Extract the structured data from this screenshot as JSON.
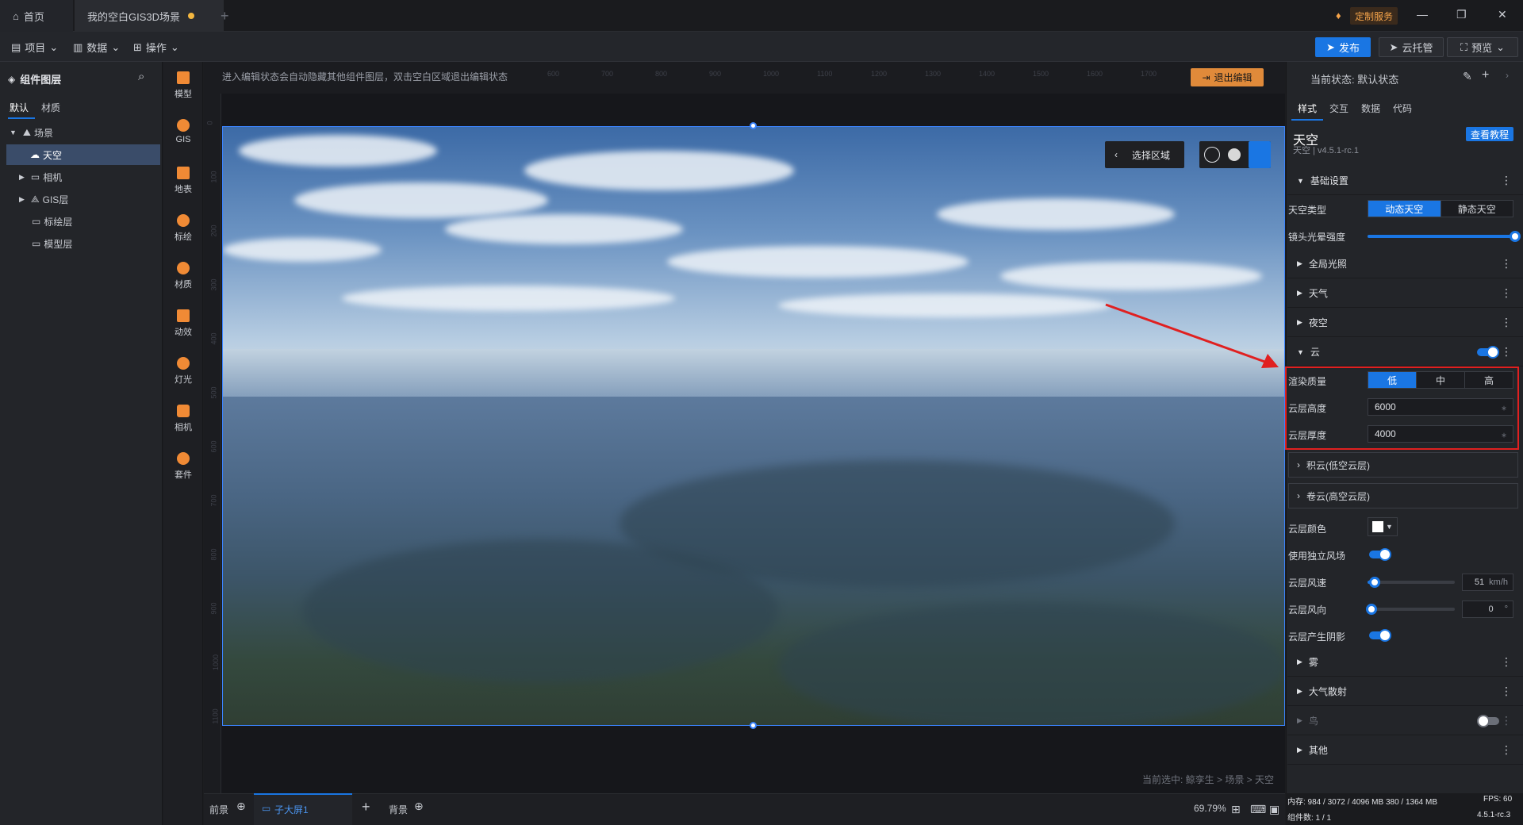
{
  "titlebar": {
    "home_tab": "首页",
    "doc_tab": "我的空白GIS3D场景",
    "custom_service": "定制服务",
    "win_min": "—",
    "win_max": "❐",
    "win_close": "✕"
  },
  "menubar": {
    "project": "项目",
    "data": "数据",
    "operate": "操作",
    "publish": "发布",
    "cloud_host": "云托管",
    "preview": "预览"
  },
  "left_panel": {
    "title": "组件图层",
    "tabs": [
      "默认",
      "材质"
    ],
    "tree": [
      {
        "label": "场景"
      },
      {
        "label": "天空"
      },
      {
        "label": "相机"
      },
      {
        "label": "GIS层"
      },
      {
        "label": "标绘层"
      },
      {
        "label": "模型层"
      }
    ]
  },
  "tools": [
    "模型",
    "GIS",
    "地表",
    "标绘",
    "材质",
    "动效",
    "灯光",
    "相机",
    "套件"
  ],
  "canvas": {
    "hint": "进入编辑状态会自动隐藏其他组件图层，双击空白区域退出编辑状态",
    "exit_edit": "退出编辑",
    "select_region": "选择区域",
    "breadcrumb": "当前选中: 鲸孪生 > 场景 > 天空",
    "ruler_top": [
      "600",
      "700",
      "800",
      "900",
      "1000",
      "1100",
      "1200",
      "1300",
      "1400",
      "1500",
      "1600",
      "1700",
      "1800"
    ],
    "ruler_left": [
      "0",
      "100",
      "200",
      "300",
      "400",
      "500",
      "600",
      "700",
      "800",
      "900",
      "1000",
      "1100"
    ]
  },
  "bottombar": {
    "foreground": "前景",
    "sub_screen": "子大屏1",
    "add": "+",
    "background": "背景",
    "zoom": "69.79%"
  },
  "right_panel": {
    "status": "当前状态: 默认状态",
    "tabs": [
      "样式",
      "交互",
      "数据",
      "代码"
    ],
    "component_title": "天空",
    "component_sub": "天空 | v4.5.1-rc.1",
    "tutorial": "查看教程",
    "sections": {
      "basic": "基础设置",
      "global_light": "全局光照",
      "weather": "天气",
      "night": "夜空",
      "cloud": "云",
      "cumulus": "积云(低空云层)",
      "cirrus": "卷云(高空云层)",
      "fog": "雾",
      "atmosphere": "大气散射",
      "bird": "鸟",
      "other": "其他"
    },
    "sky_type_label": "天空类型",
    "sky_type_options": [
      "动态天空",
      "静态天空"
    ],
    "lens_flare_label": "镜头光晕强度",
    "lens_flare_value": 1.0,
    "render_quality_label": "渲染质量",
    "render_quality_options": [
      "低",
      "中",
      "高"
    ],
    "cloud_height_label": "云层高度",
    "cloud_height": "6000",
    "cloud_thickness_label": "云层厚度",
    "cloud_thickness": "4000",
    "cloud_color_label": "云层颜色",
    "independent_wind_label": "使用独立风场",
    "wind_speed_label": "云层风速",
    "wind_speed": "51",
    "wind_speed_unit": "km/h",
    "wind_speed_fraction": 0.08,
    "wind_dir_label": "云层风向",
    "wind_dir": "0",
    "wind_dir_unit": "°",
    "cloud_shadow_label": "云层产生阴影"
  },
  "sysbar": {
    "memory": "内存: 984 / 3072 / 4096 MB  380 / 1364 MB",
    "fps": "FPS: 60",
    "components": "组件数: 1 / 1",
    "version": "4.5.1-rc.3"
  },
  "colors": {
    "accent": "#1a76e3",
    "highlight": "#e02020",
    "warning": "#e08a3a"
  }
}
